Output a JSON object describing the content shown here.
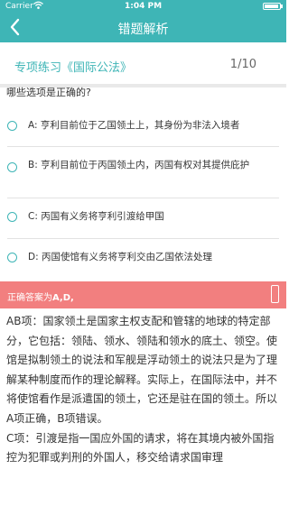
{
  "status": {
    "carrier": "Carrier",
    "time": "1:04 PM"
  },
  "nav": {
    "title": "错题解析"
  },
  "header": {
    "subject": "专项练习《国际公法》",
    "progress": "1/10"
  },
  "question": {
    "text": "哪些选项是正确的?"
  },
  "options": [
    {
      "text": "A: 亨利目前位于乙国领土上，其身份为非法入境者"
    },
    {
      "text": "B: 亨利目前位于丙国领土内，丙国有权对其提供庇护"
    },
    {
      "text": "C: 丙国有义务将亨利引渡给甲国"
    },
    {
      "text": "D: 丙国使馆有义务将亨利交由乙国依法处理"
    }
  ],
  "answer": {
    "label": "正确答案为",
    "value": "A,D,"
  },
  "explanation": {
    "para1": "AB项：国家领土是国家主权支配和管辖的地球的特定部分，它包括：领陆、领水、领陆和领水的底土、领空。使馆是拟制领土的说法和军舰是浮动领土的说法只是为了理解某种制度而作的理论解释。实际上，在国际法中，并不将使馆看作是派遣国的领土，它还是驻在国的领土。所以A项正确，B项错误。",
    "para2": "C项：引渡是指一国应外国的请求，将在其境内被外国指控为犯罪或判刑的外国人，移交给请求国审理"
  }
}
